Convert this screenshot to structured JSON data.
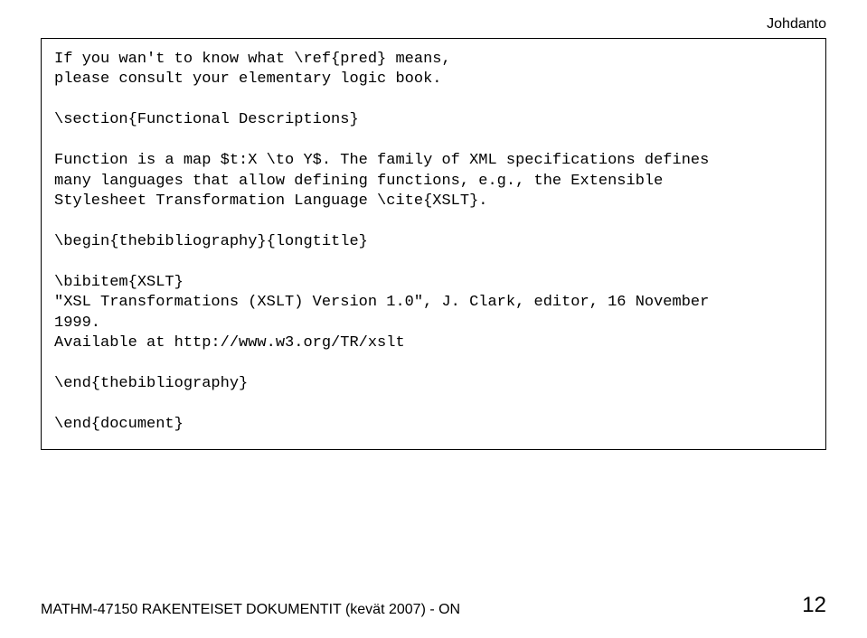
{
  "header": {
    "section_title": "Johdanto"
  },
  "code": {
    "content": "If you wan't to know what \\ref{pred} means,\nplease consult your elementary logic book.\n\n\\section{Functional Descriptions}\n\nFunction is a map $t:X \\to Y$. The family of XML specifications defines\nmany languages that allow defining functions, e.g., the Extensible\nStylesheet Transformation Language \\cite{XSLT}.\n\n\\begin{thebibliography}{longtitle}\n\n\\bibitem{XSLT}\n\"XSL Transformations (XSLT) Version 1.0\", J. Clark, editor, 16 November\n1999.\nAvailable at http://www.w3.org/TR/xslt\n\n\\end{thebibliography}\n\n\\end{document}"
  },
  "footer": {
    "course_info": "MATHM-47150 RAKENTEISET DOKUMENTIT (kevät 2007) - ON",
    "page_number": "12"
  }
}
